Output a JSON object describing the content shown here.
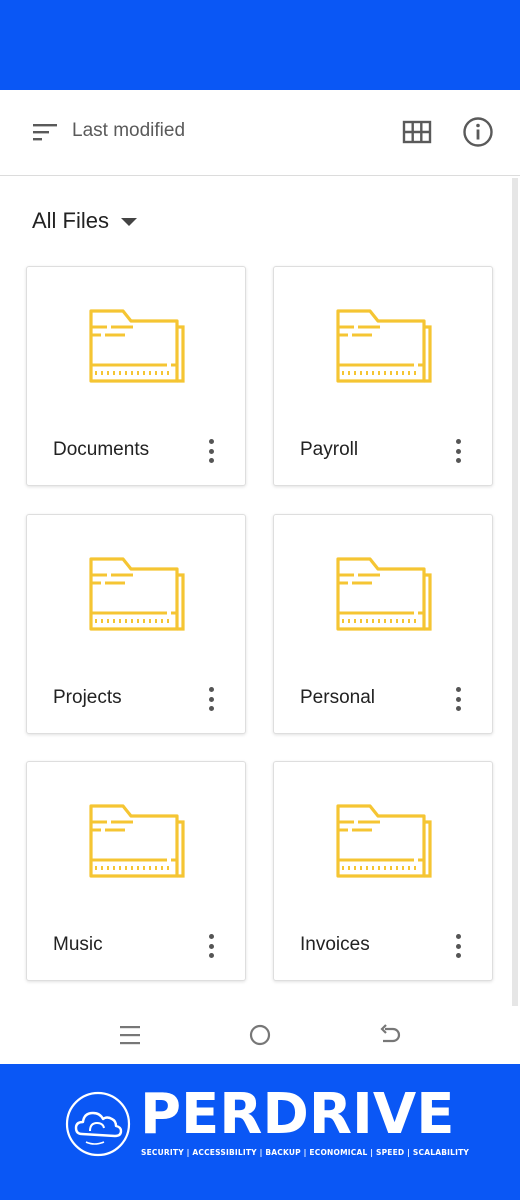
{
  "toolbar": {
    "sort_label": "Last modified",
    "sort_icon": "sort-lines-icon",
    "view_icon": "grid-view-icon",
    "info_icon": "info-icon"
  },
  "files_header": {
    "title": "All Files",
    "dropdown_icon": "caret-down-icon"
  },
  "folders": [
    {
      "name": "Documents"
    },
    {
      "name": "Payroll"
    },
    {
      "name": "Projects"
    },
    {
      "name": "Personal"
    },
    {
      "name": "Music"
    },
    {
      "name": "Invoices"
    }
  ],
  "nav": {
    "recents_icon": "recents-lines-icon",
    "home_icon": "home-circle-icon",
    "back_icon": "back-arrow-icon"
  },
  "brand": {
    "name": "PERDRIVE",
    "tagline": "SECURITY | ACCESSIBILITY | BACKUP | ECONOMICAL | SPEED | SCALABILITY",
    "logo_icon": "cloud-logo-icon"
  },
  "colors": {
    "brand_blue": "#0a57f5",
    "folder_yellow": "#f5c533",
    "text_dark": "#222222",
    "text_muted": "#5a5a5a"
  }
}
